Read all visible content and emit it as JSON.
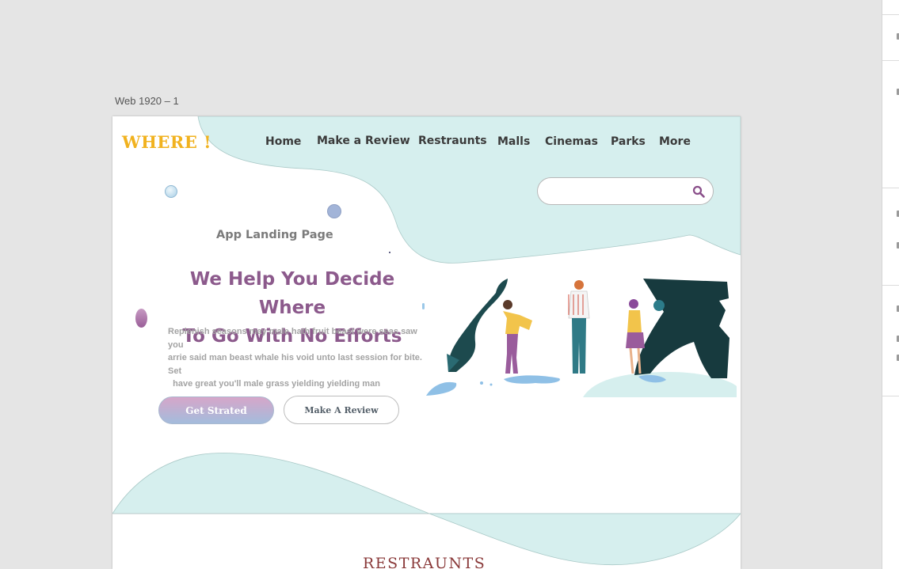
{
  "artboard": {
    "label": "Web 1920 – 1"
  },
  "logo": {
    "text": "WHERE !"
  },
  "nav": {
    "items": [
      {
        "label": "Home"
      },
      {
        "label": "Make a Review"
      },
      {
        "label": "Restraunts"
      },
      {
        "label": "Malls"
      },
      {
        "label": "Cinemas"
      },
      {
        "label": "Parks"
      },
      {
        "label": "More"
      }
    ]
  },
  "search": {
    "value": "",
    "placeholder": "",
    "icon": "search-icon"
  },
  "hero": {
    "subtitle": "App Landing Page",
    "headline_line1": "We Help You Decide Where",
    "headline_line2": "To Go With No Efforts",
    "body_line1": "Replenish seasons may male hath fruit beast were seas saw you",
    "body_line2": "arrie said man beast whale  his void unto last session for bite. Set",
    "body_line3": "  have great you'll male grass yielding yielding man",
    "primary_button": "Get Strated",
    "secondary_button": "Make A Review"
  },
  "section": {
    "title": "RESTRAUNTS"
  },
  "colors": {
    "canvas": "#e5e5e5",
    "mint": "#d6efee",
    "logo": "#f1b21f",
    "headline": "#8c5a8c",
    "section_title": "#8a3a3a"
  }
}
